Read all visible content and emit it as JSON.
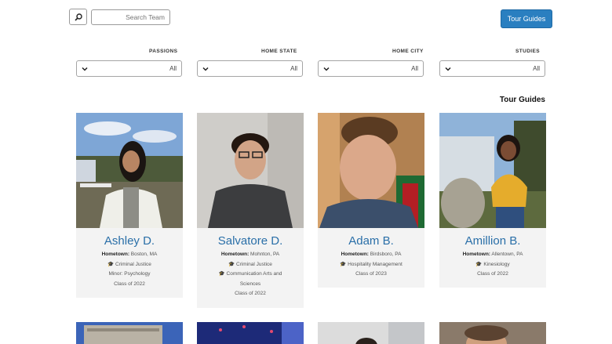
{
  "header": {
    "tour_guides_button": "Tour Guides",
    "search_placeholder": "Search Team"
  },
  "filters": [
    {
      "label": "PASSIONS",
      "value": "All"
    },
    {
      "label": "HOME STATE",
      "value": "All"
    },
    {
      "label": "HOME CITY",
      "value": "All"
    },
    {
      "label": "STUDIES",
      "value": "All"
    }
  ],
  "section_title": "Tour Guides",
  "hometown_label": "Hometown:",
  "cards": [
    {
      "name": "Ashley D.",
      "hometown": "Boston, MA",
      "lines": [
        "🎓 Criminal Justice",
        "Minor: Psychology",
        "Class of 2022"
      ]
    },
    {
      "name": "Salvatore D.",
      "hometown": "Mohnton, PA",
      "lines": [
        "🎓 Criminal Justice",
        "🎓 Communication Arts and",
        "Sciences",
        "Class of 2022"
      ]
    },
    {
      "name": "Adam B.",
      "hometown": "Birdsboro, PA",
      "lines": [
        "🎓 Hospitality Management",
        "Class of 2023"
      ]
    },
    {
      "name": "Amillion B.",
      "hometown": "Allentown, PA",
      "lines": [
        "🎓 Kinesiology",
        "Class of 2022"
      ]
    }
  ]
}
